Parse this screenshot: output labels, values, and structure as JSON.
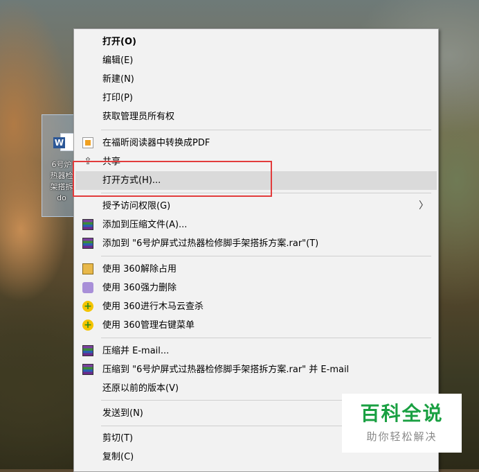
{
  "desktop_icon": {
    "type_icon": "word-doc-icon",
    "badge": "W",
    "label_lines": [
      "6号炉",
      "热器检",
      "架搭拆",
      "do"
    ]
  },
  "menu": {
    "items": [
      {
        "label": "打开(O)",
        "bold": true
      },
      {
        "label": "编辑(E)"
      },
      {
        "label": "新建(N)"
      },
      {
        "label": "打印(P)"
      },
      {
        "label": "获取管理员所有权"
      },
      {
        "label": "在福昕阅读器中转换成PDF",
        "icon": "pdf-convert-icon"
      },
      {
        "label": "共享",
        "icon": "share-icon"
      },
      {
        "label": "打开方式(H)...",
        "hover": true
      },
      {
        "label": "授予访问权限(G)",
        "submenu": true
      },
      {
        "label": "添加到压缩文件(A)...",
        "icon": "winrar-icon"
      },
      {
        "label": "添加到 \"6号炉屏式过热器检修脚手架搭拆方案.rar\"(T)",
        "icon": "winrar-icon"
      },
      {
        "label": "使用 360解除占用",
        "icon": "360-unlock-icon"
      },
      {
        "label": "使用 360强力删除",
        "icon": "360-shred-icon"
      },
      {
        "label": "使用 360进行木马云查杀",
        "icon": "360-scan-icon"
      },
      {
        "label": "使用 360管理右键菜单",
        "icon": "360-menu-icon"
      },
      {
        "label": "压缩并 E-mail...",
        "icon": "winrar-icon"
      },
      {
        "label": "压缩到 \"6号炉屏式过热器检修脚手架搭拆方案.rar\" 并 E-mail",
        "icon": "winrar-icon"
      },
      {
        "label": "还原以前的版本(V)"
      },
      {
        "label": "发送到(N)"
      },
      {
        "label": "剪切(T)"
      },
      {
        "label": "复制(C)"
      }
    ],
    "submenu_arrow": "〉"
  },
  "watermark": {
    "title": "百科全说",
    "subtitle": "助你轻松解决"
  },
  "colors": {
    "highlight_box": "#e23b3b",
    "watermark_green": "#1aa042",
    "menu_bg": "#f2f2f2",
    "hover_bg": "#dadada"
  }
}
